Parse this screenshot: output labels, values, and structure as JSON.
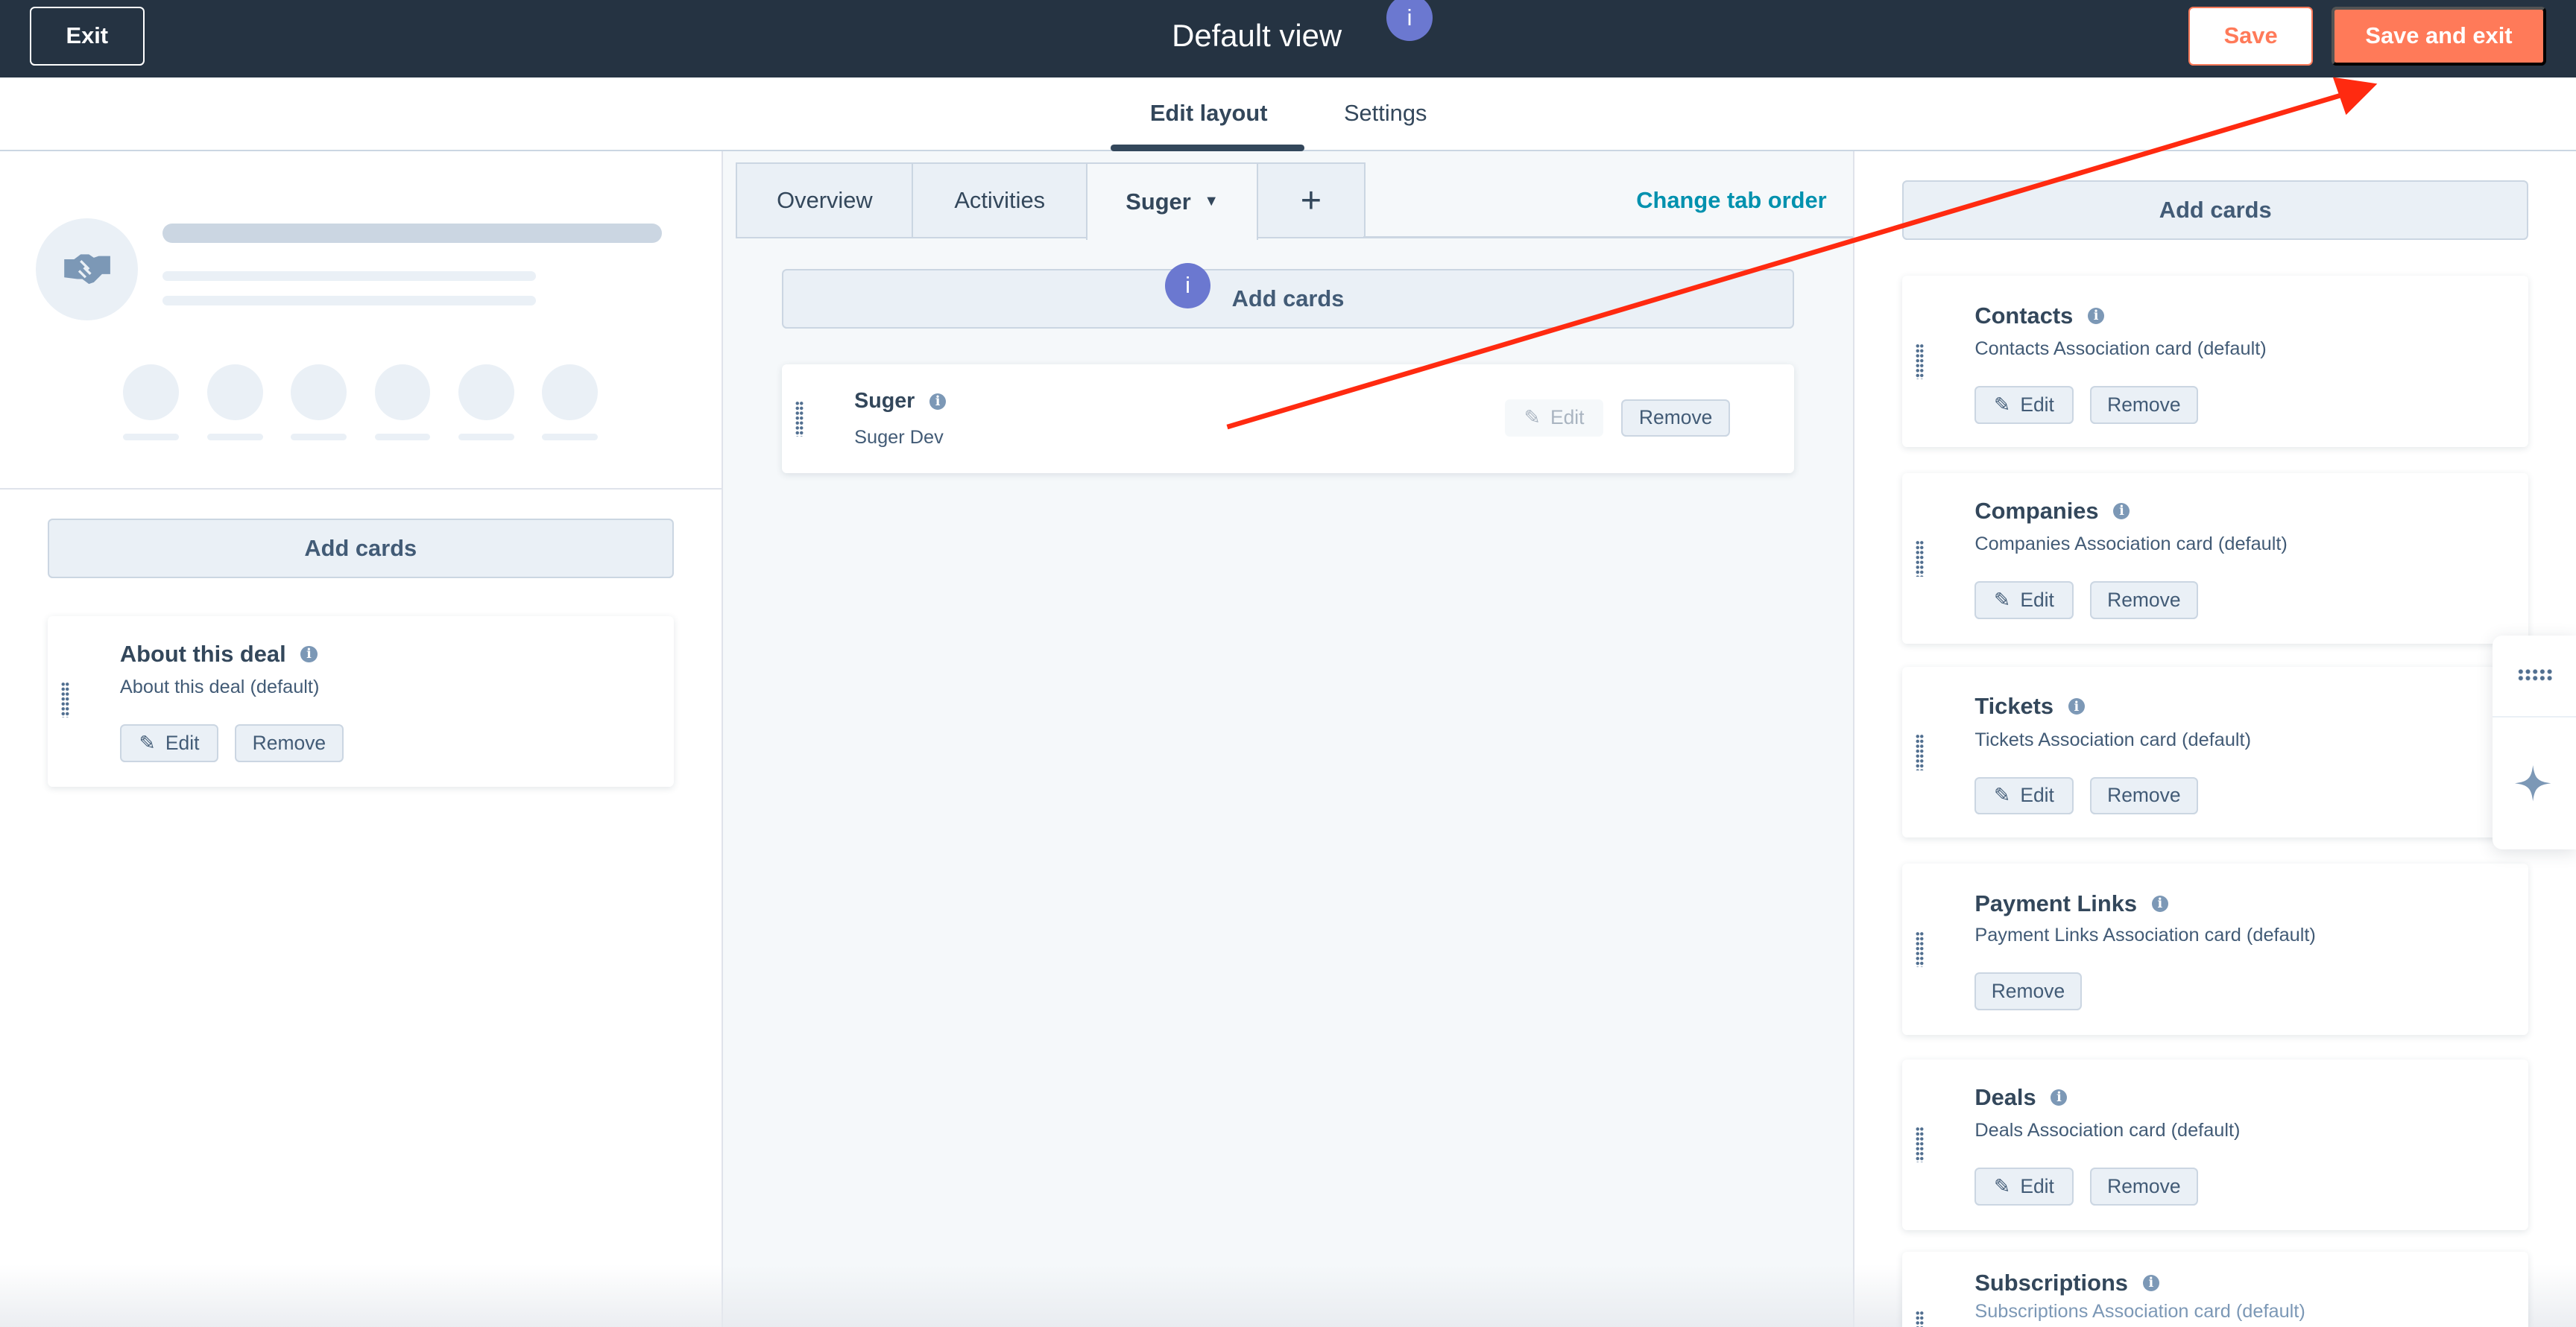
{
  "topbar": {
    "exit_label": "Exit",
    "title": "Default view",
    "info_label": "i",
    "save_label": "Save",
    "save_exit_label": "Save and exit"
  },
  "tabs_nav": [
    {
      "label": "Edit layout",
      "active": true
    },
    {
      "label": "Settings",
      "active": false
    }
  ],
  "left": {
    "add_cards_label": "Add cards",
    "cards": [
      {
        "title": "About this deal",
        "subtitle": "About this deal (default)",
        "edit_label": "Edit",
        "remove_label": "Remove"
      }
    ]
  },
  "middle": {
    "tabs": [
      {
        "label": "Overview"
      },
      {
        "label": "Activities"
      },
      {
        "label": "Suger",
        "active": true
      },
      {
        "label": "+"
      }
    ],
    "change_tab_order_label": "Change tab order",
    "add_cards_label": "Add cards",
    "info_label": "i",
    "cards": [
      {
        "title": "Suger",
        "subtitle": "Suger Dev",
        "edit_label": "Edit",
        "edit_disabled": true,
        "remove_label": "Remove"
      }
    ]
  },
  "right": {
    "add_cards_label": "Add cards",
    "cards": [
      {
        "title": "Contacts",
        "subtitle": "Contacts Association card (default)",
        "edit_label": "Edit",
        "remove_label": "Remove"
      },
      {
        "title": "Companies",
        "subtitle": "Companies Association card (default)",
        "edit_label": "Edit",
        "remove_label": "Remove"
      },
      {
        "title": "Tickets",
        "subtitle": "Tickets Association card (default)",
        "edit_label": "Edit",
        "remove_label": "Remove"
      },
      {
        "title": "Payment Links",
        "subtitle": "Payment Links Association card (default)",
        "remove_label": "Remove"
      },
      {
        "title": "Deals",
        "subtitle": "Deals Association card (default)",
        "edit_label": "Edit",
        "remove_label": "Remove"
      },
      {
        "title": "Subscriptions",
        "subtitle": "Subscriptions Association card (default)"
      }
    ]
  },
  "icons": {
    "avatar": "handshake-icon",
    "drag": "drag-handle-icon",
    "edit": "pencil-icon",
    "info": "info-icon",
    "widget_top": "grid-icon",
    "widget_bottom": "sparkle-icon"
  },
  "colors": {
    "topbar": "#253342",
    "accent": "#ff7a59",
    "link": "#0091ae",
    "info_badge": "#6b78d0",
    "annotation_arrow": "#ff2a10"
  }
}
